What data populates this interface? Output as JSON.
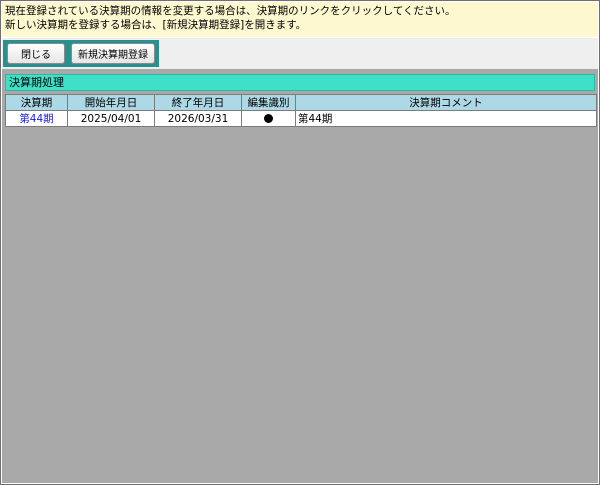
{
  "notice": {
    "line1": "現在登録されている決算期の情報を変更する場合は、決算期のリンクをクリックしてください。",
    "line2": "新しい決算期を登録する場合は、[新規決算期登録]を開きます。"
  },
  "toolbar": {
    "close_label": "閉じる",
    "new_label": "新規決算期登録"
  },
  "section": {
    "title": "決算期処理"
  },
  "table": {
    "headers": {
      "period": "決算期",
      "start_date": "開始年月日",
      "end_date": "終了年月日",
      "edit_flag": "編集識別",
      "comment": "決算期コメント"
    },
    "rows": [
      {
        "period": "第44期",
        "start_date": "2025/04/01",
        "end_date": "2026/03/31",
        "edit_flag": "●",
        "comment": "第44期"
      }
    ]
  },
  "colors": {
    "notice_bg": "#fdf8cf",
    "toolbar_group": "#2a8f8f",
    "section_title_bg": "#3fe0c8",
    "header_bg": "#add8e6",
    "link": "#1a1adf",
    "content_bg": "#a9a9a9"
  }
}
